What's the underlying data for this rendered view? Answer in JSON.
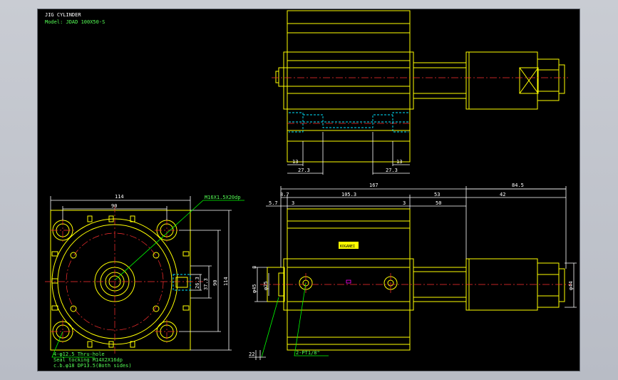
{
  "title_block": {
    "line1": "JIG CYLINDER",
    "line2": "Model: JDAD 100X50-S"
  },
  "dimensions": {
    "top_left_13": "13",
    "top_left_273": "27.3",
    "top_right_273": "27.3",
    "top_right_13": "13",
    "overall_167": "167",
    "right_845": "84.5",
    "d_87": "8.7",
    "d_1053": "105.3",
    "d_53": "53",
    "d_57": "5.7",
    "d_3a": "3",
    "d_3b": "3",
    "d_50": "50",
    "d_42": "42",
    "front_114_top": "114",
    "front_90_top": "90",
    "front_263": "26.3",
    "front_373": "37.3",
    "front_90_right": "90",
    "front_114_right": "114",
    "phi45": "φ45",
    "phi25": "φ25",
    "phi44": "φ44",
    "d_22": "22",
    "d_8": "8"
  },
  "callouts": {
    "thread": "M16X1.5X20dp",
    "hole_1": "4-φ12.5 Thru-hole",
    "hole_2": "Seal tocking  M14X2X16dp",
    "hole_3": "c.b.φ18 DP13.5(Both sides)",
    "port": "2-PT1/8\""
  },
  "label_plate": "KOGANEI",
  "colors": {
    "outline": "#ffff00",
    "dimension": "#ffffff",
    "leader": "#00ff00",
    "centerline": "#ff3030",
    "hidden": "#00e5ff",
    "background": "#000000"
  }
}
